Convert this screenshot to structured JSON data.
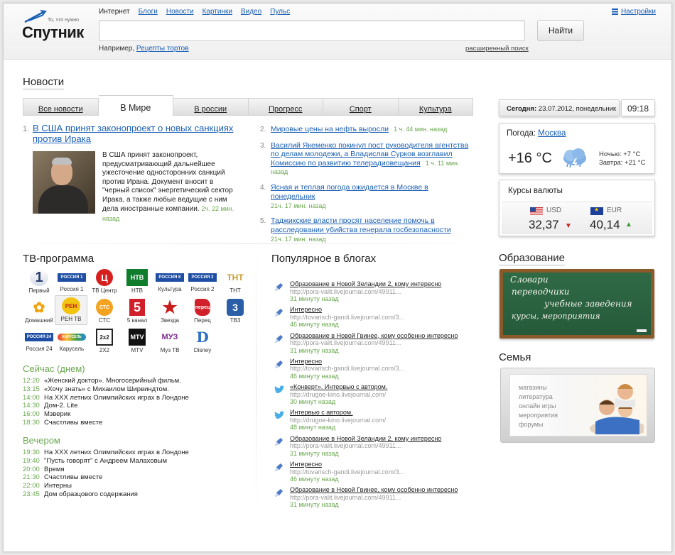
{
  "header": {
    "logo_name": "Спутник",
    "logo_tagline": "То, что нужно",
    "services": [
      "Интернет",
      "Блоги",
      "Новости",
      "Картинки",
      "Видео",
      "Пульс"
    ],
    "settings_label": "Настройки",
    "search_value": "",
    "search_button": "Найти",
    "example_prefix": "Например,",
    "example_link": "Рецепты тортов",
    "advanced_search": "расширенный поиск"
  },
  "news": {
    "title": "Новости",
    "tabs": [
      "Все новости",
      "В Мире",
      "В россии",
      "Прогресс",
      "Спорт",
      "Культура"
    ],
    "active_tab": "В Мире",
    "lead": {
      "num": "1.",
      "title": "В США принят законопроект о новых санкциях против Ирака",
      "body": "В США принят законопроект, предусматривающий дальнейшее ужесточение односторонних санкций против Ирана. Документ вносит в \"черный список\" энергетический сектор Ирака, а также любые ведущие с ним дела иностранные компании.",
      "time": "2ч. 22 мин. назад"
    },
    "items": [
      {
        "num": "2.",
        "title": "Мировые цены на нефть выросли",
        "time": "1 ч. 44 мин. назад"
      },
      {
        "num": "3.",
        "title": "Василий Якеменко покинул пост руководителя агентства по делам молодежи, а Владислав Сурков возглавил Комиссию по развитию телерадиовещания",
        "time": "1 ч. 11 мин. назад"
      },
      {
        "num": "4.",
        "title": "Ясная и теплая погода ожидается в Москве в понедельник",
        "time": "21ч. 17 мин. назад"
      },
      {
        "num": "5.",
        "title": "Таджикские власти просят население помочь в расследовании убийства генерала госбезопасности",
        "time": "21ч. 17 мин. назад"
      }
    ]
  },
  "sidebar": {
    "today_label": "Сегодня:",
    "today_value": "23.07.2012, понедельник",
    "clock": "09:18",
    "weather_label": "Погода:",
    "weather_city": "Москва",
    "weather_temp": "+16 °C",
    "weather_night": "Ночью: +7 °C",
    "weather_tomorrow": "Завтра: +21 °C",
    "fx_label": "Курсы валюты",
    "usd_code": "USD",
    "usd_value": "32,37",
    "eur_code": "EUR",
    "eur_value": "40,14",
    "edu_title": "Образование",
    "edu_board_lines": [
      "Словари",
      "переводчики",
      "учебные заведения",
      "курсы, мероприятия",
      ""
    ],
    "family_title": "Семья",
    "family_links": [
      "магазины",
      "литература",
      "онлайн игры",
      "мероприятия",
      "форумы"
    ]
  },
  "tv": {
    "title": "ТВ-программа",
    "channels": [
      "Первый",
      "Россия 1",
      "ТВ Центр",
      "НТВ",
      "Культура",
      "Россия 2",
      "ТНТ",
      "Домашний",
      "РЕН ТВ",
      "СТС",
      "5 канал",
      "Звезда",
      "Перец",
      "ТВ3",
      "Россия 24",
      "Карусель",
      "2Х2",
      "MTV",
      "Муз ТВ",
      "Disney"
    ],
    "logos": {
      "perviy": "1",
      "rossiya1": "РОССИЯ 1",
      "tvc": "Ц",
      "ntv": "НТВ",
      "kultura": "РОССИЯ К",
      "rossiya2": "РОССИЯ 2",
      "tnt": "ТНТ",
      "domashniy": "✿",
      "ren": "РЕН",
      "sts": "СТС",
      "five": "5",
      "zvezda": "★",
      "perets": "перец",
      "tv3": "3",
      "r24": "РОССИЯ 24",
      "karusel": "КАРУСЕЛЬ",
      "2x2": "2x2",
      "mtv": "MTV",
      "muz": "МУЗ",
      "disney": "D"
    },
    "now_title": "Сейчас (днем)",
    "now": [
      {
        "t": "12:20",
        "p": "«Женский доктор». Многосерийный фильм."
      },
      {
        "t": "13:15",
        "p": "«Хочу знать» с Михаилом Ширвиндтом."
      },
      {
        "t": "14:00",
        "p": "На XXX летних Олимпийских играх в Лондоне"
      },
      {
        "t": "14:30",
        "p": "Дом-2. Lite"
      },
      {
        "t": "16:00",
        "p": "Мзверик"
      },
      {
        "t": "18:30",
        "p": "Счастливы вместе"
      }
    ],
    "evening_title": "Вечером",
    "evening": [
      {
        "t": "19:30",
        "p": "На XXX летних Олимпийских играх в Лондоне"
      },
      {
        "t": "19:40",
        "p": "\"Пусть говорят\" с Андреем Малаховым"
      },
      {
        "t": "20:00",
        "p": "Время"
      },
      {
        "t": "21:30",
        "p": "Счастливы вместе"
      },
      {
        "t": "22:00",
        "p": "Интерны"
      },
      {
        "t": "23:45",
        "p": "Дом образцового содержания"
      }
    ]
  },
  "blogs": {
    "title": "Популярное в блогах",
    "items": [
      {
        "icon": "lj",
        "title": "Образование в Новой Зеландии 2, кому интересно",
        "url": "http://pora-valit.livejournal.com/49911...",
        "time": "31 минуту назад"
      },
      {
        "icon": "lj",
        "title": "Интересно",
        "url": "http://tovarisch-gandi.livejournal.com/3...",
        "time": "46 минуту назад"
      },
      {
        "icon": "lj",
        "title": "Образование в Новой Гвинее, кому особенно интересно",
        "url": "http://pora-valit.livejournal.com/49911...",
        "time": "31 минуту назад"
      },
      {
        "icon": "lj",
        "title": "Интересно",
        "url": "http://tovarisch-gandi.livejournal.com/3...",
        "time": "46 минуту назад"
      },
      {
        "icon": "tw",
        "title": "«Конверт». Интервью с автором.",
        "url": "http://drugoe-kino.livejournal.com/",
        "time": "30 минут назад"
      },
      {
        "icon": "tw",
        "title": "Интервью с автором.",
        "url": "http://drugoe-kino.livejournal.com/",
        "time": "48 минут назад"
      },
      {
        "icon": "lj",
        "title": "Образование в Новой Зеландии 2, кому интересно",
        "url": "http://pora-valit.livejournal.com/49911...",
        "time": "31 минуту назад"
      },
      {
        "icon": "lj",
        "title": "Интересно",
        "url": "http://tovarisch-gandi.livejournal.com/3...",
        "time": "46 минуту назад"
      },
      {
        "icon": "lj",
        "title": "Образование в Новой Гвинее, кому особенно интересно",
        "url": "http://pora-valit.livejournal.com/49911...",
        "time": "31 минуту назад"
      }
    ]
  }
}
